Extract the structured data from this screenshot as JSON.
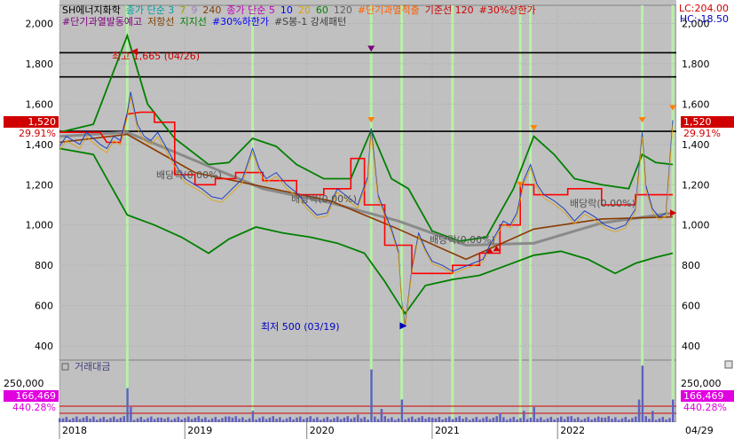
{
  "legend": {
    "line1": [
      {
        "text": "SH에너지화학",
        "color": "#000000"
      },
      {
        "text": "종가 단순 3",
        "color": "#00a0a0"
      },
      {
        "text": "7",
        "color": "#a0a000"
      },
      {
        "text": "9",
        "color": "#a080c0"
      },
      {
        "text": "240",
        "color": "#804000"
      },
      {
        "text": "종가 단순 5",
        "color": "#c000c0"
      },
      {
        "text": "10",
        "color": "#0000ff"
      },
      {
        "text": "20",
        "color": "#e0a000"
      },
      {
        "text": "60",
        "color": "#008000"
      },
      {
        "text": "120",
        "color": "#606060"
      },
      {
        "text": "#단기과열적출",
        "color": "#ff6000"
      },
      {
        "text": "기준선 120",
        "color": "#d00000"
      },
      {
        "text": "#30%상한가",
        "color": "#d00000"
      }
    ],
    "line2": [
      {
        "text": "#단기과열발동예고",
        "color": "#800080"
      },
      {
        "text": "저항선",
        "color": "#804000"
      },
      {
        "text": "지지선",
        "color": "#008000"
      },
      {
        "text": "#30%하한가",
        "color": "#0000ff"
      },
      {
        "text": "#S봉-1 강세패턴",
        "color": "#404040"
      }
    ]
  },
  "lc_label": "LC:204.00",
  "hc_label": "HC:-18.50",
  "price_badge": "1,520",
  "pct_badge": "29.91%",
  "volume_title": "거래대금",
  "volume_badge": "166,469",
  "volume_pct_badge": "440.28%",
  "volume_tick": "250,000",
  "date_label": "04/29",
  "annotations": {
    "high": "최고 1,665 (04/26)",
    "low": "최저 500 (03/19)",
    "div1": "배당락(0.00%)",
    "div2": "배당락(0.00%)",
    "div3": "배당락(0.00%)",
    "div4": "배당락(0.00%)"
  },
  "chart_data": {
    "type": "line",
    "yticks": [
      "2,000",
      "1,800",
      "1,600",
      "1,400",
      "1,200",
      "1,000",
      "800",
      "600",
      "400"
    ],
    "ylim": [
      330,
      2090
    ],
    "xticks": [
      "2018",
      "2019",
      "2020",
      "2021",
      "2022"
    ],
    "hlines": [
      1465,
      1735,
      1855
    ],
    "price": [
      [
        0,
        1390
      ],
      [
        2,
        1440
      ],
      [
        4,
        1420
      ],
      [
        6,
        1400
      ],
      [
        8,
        1460
      ],
      [
        10,
        1430
      ],
      [
        12,
        1400
      ],
      [
        14,
        1380
      ],
      [
        16,
        1440
      ],
      [
        18,
        1420
      ],
      [
        20,
        1560
      ],
      [
        21,
        1660
      ],
      [
        23,
        1500
      ],
      [
        25,
        1440
      ],
      [
        27,
        1420
      ],
      [
        29,
        1460
      ],
      [
        31,
        1400
      ],
      [
        33,
        1340
      ],
      [
        35,
        1280
      ],
      [
        37,
        1230
      ],
      [
        40,
        1200
      ],
      [
        42,
        1180
      ],
      [
        45,
        1140
      ],
      [
        48,
        1130
      ],
      [
        51,
        1180
      ],
      [
        54,
        1230
      ],
      [
        57,
        1380
      ],
      [
        59,
        1280
      ],
      [
        61,
        1230
      ],
      [
        64,
        1260
      ],
      [
        67,
        1200
      ],
      [
        70,
        1160
      ],
      [
        73,
        1100
      ],
      [
        76,
        1050
      ],
      [
        79,
        1060
      ],
      [
        82,
        1180
      ],
      [
        85,
        1140
      ],
      [
        88,
        1100
      ],
      [
        91,
        1240
      ],
      [
        92,
        1480
      ],
      [
        94,
        1150
      ],
      [
        96,
        1060
      ],
      [
        98,
        980
      ],
      [
        100,
        870
      ],
      [
        101,
        620
      ],
      [
        102,
        500
      ],
      [
        104,
        780
      ],
      [
        106,
        960
      ],
      [
        108,
        880
      ],
      [
        110,
        820
      ],
      [
        113,
        800
      ],
      [
        116,
        770
      ],
      [
        119,
        790
      ],
      [
        122,
        810
      ],
      [
        125,
        830
      ],
      [
        127,
        900
      ],
      [
        129,
        960
      ],
      [
        131,
        1020
      ],
      [
        133,
        1000
      ],
      [
        135,
        1060
      ],
      [
        137,
        1220
      ],
      [
        139,
        1300
      ],
      [
        141,
        1200
      ],
      [
        143,
        1150
      ],
      [
        146,
        1120
      ],
      [
        149,
        1080
      ],
      [
        152,
        1020
      ],
      [
        155,
        1070
      ],
      [
        158,
        1040
      ],
      [
        161,
        1000
      ],
      [
        164,
        980
      ],
      [
        167,
        1000
      ],
      [
        170,
        1080
      ],
      [
        172,
        1460
      ],
      [
        173,
        1200
      ],
      [
        175,
        1080
      ],
      [
        177,
        1040
      ],
      [
        179,
        1060
      ],
      [
        181,
        1520
      ]
    ],
    "ma_slow": [
      [
        0,
        1440
      ],
      [
        20,
        1460
      ],
      [
        40,
        1320
      ],
      [
        60,
        1180
      ],
      [
        80,
        1110
      ],
      [
        100,
        1020
      ],
      [
        120,
        900
      ],
      [
        140,
        910
      ],
      [
        160,
        1010
      ],
      [
        181,
        1060
      ]
    ],
    "ma_mid": [
      [
        0,
        1410
      ],
      [
        20,
        1450
      ],
      [
        40,
        1260
      ],
      [
        60,
        1190
      ],
      [
        80,
        1120
      ],
      [
        100,
        980
      ],
      [
        120,
        830
      ],
      [
        140,
        980
      ],
      [
        160,
        1030
      ],
      [
        181,
        1040
      ]
    ],
    "band_upper": [
      [
        0,
        1460
      ],
      [
        10,
        1500
      ],
      [
        20,
        1940
      ],
      [
        26,
        1600
      ],
      [
        34,
        1430
      ],
      [
        44,
        1300
      ],
      [
        50,
        1310
      ],
      [
        57,
        1430
      ],
      [
        64,
        1390
      ],
      [
        70,
        1300
      ],
      [
        78,
        1230
      ],
      [
        86,
        1230
      ],
      [
        92,
        1470
      ],
      [
        98,
        1230
      ],
      [
        103,
        1180
      ],
      [
        110,
        970
      ],
      [
        118,
        920
      ],
      [
        126,
        940
      ],
      [
        134,
        1180
      ],
      [
        140,
        1440
      ],
      [
        146,
        1350
      ],
      [
        152,
        1230
      ],
      [
        160,
        1200
      ],
      [
        168,
        1180
      ],
      [
        172,
        1350
      ],
      [
        176,
        1310
      ],
      [
        181,
        1300
      ]
    ],
    "band_lower": [
      [
        0,
        1380
      ],
      [
        10,
        1350
      ],
      [
        20,
        1050
      ],
      [
        28,
        1000
      ],
      [
        36,
        940
      ],
      [
        44,
        860
      ],
      [
        50,
        930
      ],
      [
        58,
        990
      ],
      [
        66,
        960
      ],
      [
        74,
        940
      ],
      [
        82,
        910
      ],
      [
        90,
        860
      ],
      [
        96,
        720
      ],
      [
        102,
        560
      ],
      [
        108,
        700
      ],
      [
        116,
        730
      ],
      [
        124,
        750
      ],
      [
        132,
        800
      ],
      [
        140,
        850
      ],
      [
        148,
        870
      ],
      [
        156,
        830
      ],
      [
        164,
        760
      ],
      [
        170,
        810
      ],
      [
        176,
        840
      ],
      [
        181,
        860
      ]
    ],
    "resistance": [
      [
        0,
        1460
      ],
      [
        12,
        1460
      ],
      [
        14,
        1410
      ],
      [
        18,
        1410
      ],
      [
        20,
        1550
      ],
      [
        24,
        1560
      ],
      [
        28,
        1560
      ],
      [
        28,
        1510
      ],
      [
        34,
        1510
      ],
      [
        34,
        1250
      ],
      [
        40,
        1250
      ],
      [
        40,
        1200
      ],
      [
        46,
        1200
      ],
      [
        46,
        1230
      ],
      [
        52,
        1230
      ],
      [
        52,
        1260
      ],
      [
        60,
        1260
      ],
      [
        60,
        1220
      ],
      [
        70,
        1220
      ],
      [
        70,
        1150
      ],
      [
        78,
        1150
      ],
      [
        78,
        1180
      ],
      [
        86,
        1180
      ],
      [
        86,
        1330
      ],
      [
        90,
        1330
      ],
      [
        90,
        1100
      ],
      [
        96,
        1100
      ],
      [
        96,
        900
      ],
      [
        104,
        900
      ],
      [
        104,
        760
      ],
      [
        116,
        760
      ],
      [
        116,
        800
      ],
      [
        124,
        800
      ],
      [
        124,
        860
      ],
      [
        130,
        860
      ],
      [
        130,
        1000
      ],
      [
        136,
        1000
      ],
      [
        136,
        1200
      ],
      [
        140,
        1200
      ],
      [
        140,
        1150
      ],
      [
        150,
        1150
      ],
      [
        150,
        1180
      ],
      [
        160,
        1180
      ],
      [
        160,
        1100
      ],
      [
        170,
        1100
      ],
      [
        170,
        1150
      ],
      [
        181,
        1150
      ]
    ],
    "volume": [
      [
        0,
        10
      ],
      [
        10,
        15
      ],
      [
        20,
        90
      ],
      [
        21,
        40
      ],
      [
        30,
        12
      ],
      [
        50,
        15
      ],
      [
        57,
        30
      ],
      [
        70,
        12
      ],
      [
        88,
        20
      ],
      [
        92,
        140
      ],
      [
        95,
        35
      ],
      [
        101,
        60
      ],
      [
        110,
        12
      ],
      [
        130,
        25
      ],
      [
        137,
        30
      ],
      [
        140,
        40
      ],
      [
        150,
        15
      ],
      [
        160,
        12
      ],
      [
        171,
        60
      ],
      [
        172,
        150
      ],
      [
        175,
        30
      ],
      [
        181,
        60
      ]
    ]
  }
}
